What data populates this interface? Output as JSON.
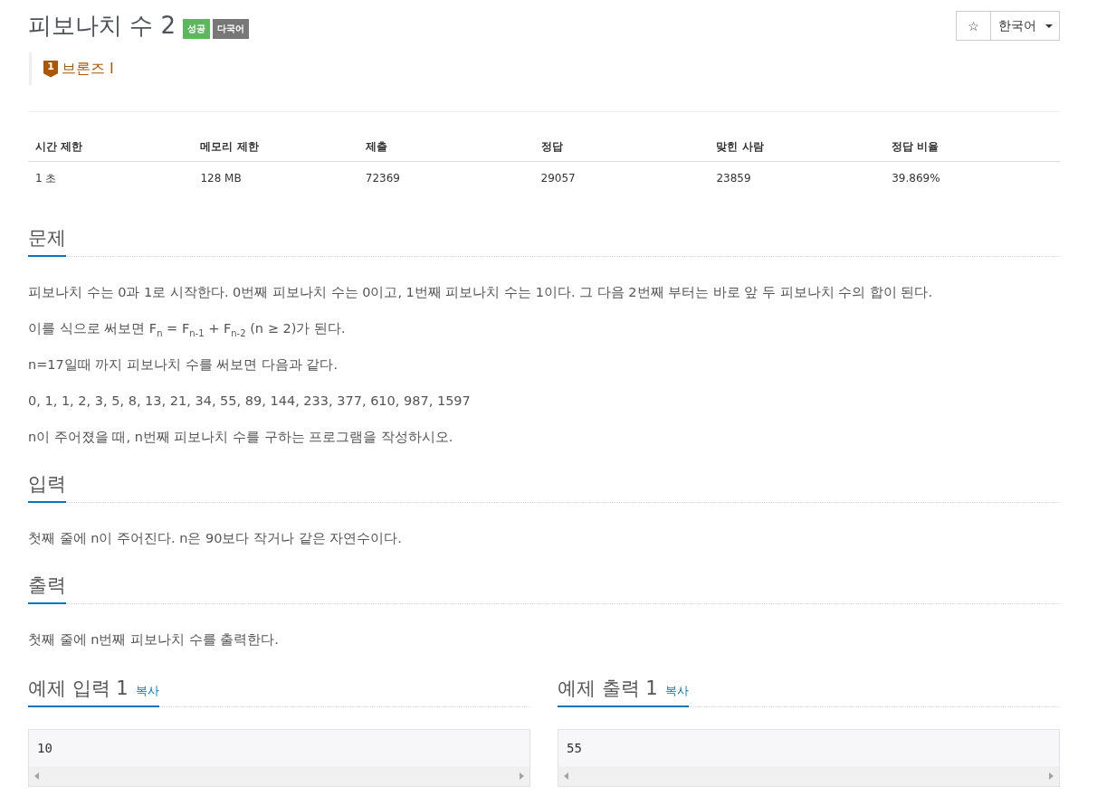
{
  "header": {
    "title": "피보나치 수 2",
    "badges": [
      {
        "label": "성공",
        "color": "#5cb85c"
      },
      {
        "label": "다국어",
        "color": "#777777"
      }
    ],
    "tier": {
      "digit": "1",
      "label": "브론즈 I"
    }
  },
  "toolbar": {
    "star": "☆",
    "language": "한국어"
  },
  "stats": {
    "columns": [
      "시간 제한",
      "메모리 제한",
      "제출",
      "정답",
      "맞힌 사람",
      "정답 비율"
    ],
    "rows": [
      [
        "1 초",
        "128 MB",
        "72369",
        "29057",
        "23859",
        "39.869%"
      ]
    ]
  },
  "sections": [
    {
      "heading": "문제",
      "paragraphs": [
        "피보나치 수는 0과 1로 시작한다. 0번째 피보나치 수는 0이고, 1번째 피보나치 수는 1이다. 그 다음 2번째 부터는 바로 앞 두 피보나치 수의 합이 된다.",
        "이를 식으로 써보면 F$_{n}$ = F$_{n-1}$ + F$_{n-2}$ (n ≥ 2)가 된다.",
        "n=17일때 까지 피보나치 수를 써보면 다음과 같다.",
        "0, 1, 1, 2, 3, 5, 8, 13, 21, 34, 55, 89, 144, 233, 377, 610, 987, 1597",
        "n이 주어졌을 때, n번째 피보나치 수를 구하는 프로그램을 작성하시오."
      ]
    },
    {
      "heading": "입력",
      "paragraphs": [
        "첫째 줄에 n이 주어진다. n은 90보다 작거나 같은 자연수이다."
      ]
    },
    {
      "heading": "출력",
      "paragraphs": [
        "첫째 줄에 n번째 피보나치 수를 출력한다."
      ]
    }
  ],
  "samples": [
    {
      "heading": "예제 입력 1",
      "copy": "복사",
      "content": "10"
    },
    {
      "heading": "예제 출력 1",
      "copy": "복사",
      "content": "55"
    }
  ]
}
